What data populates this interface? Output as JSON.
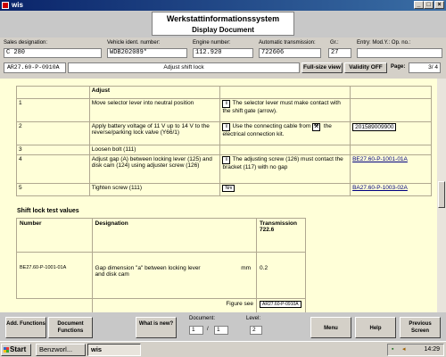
{
  "window": {
    "title": "wis"
  },
  "header": {
    "app_title": "Werkstattinformationssystem",
    "subtitle": "Display Document"
  },
  "fields": [
    {
      "label": "Sales designation:",
      "value": "C 280"
    },
    {
      "label": "Vehicle ident. number:",
      "value": "WDB202089*"
    },
    {
      "label": "Engine number:",
      "value": "112.920"
    },
    {
      "label": "Automatic transmission:",
      "value": "722606"
    },
    {
      "label": "Gr.:",
      "value": "27"
    },
    {
      "label": "Entry: Mod.Y.: Op. no.:",
      "value": ""
    }
  ],
  "infobar": {
    "doc_id": "AR27.60-P-0910A",
    "doc_title": "Adjust shift lock",
    "fullsize": "Full-size view",
    "validity": "Validity OFF",
    "page_label": "Page:",
    "page_value": "3/ 4"
  },
  "adjust_table": {
    "header": "Adjust",
    "rows": [
      {
        "num": "1",
        "step": "Move selector lever into neutral position",
        "note": "The selector lever must make contact with the shift gate (arrow).",
        "ref": ""
      },
      {
        "num": "2",
        "step": "Apply battery voltage of 11 V up to 14 V to the reverse/parking lock valve (Y66/1)",
        "note": "Use the connecting cable from",
        "note2": "the electrical connection kit.",
        "ref": "201589009900"
      },
      {
        "num": "3",
        "step": "Loosen bolt (111)",
        "note": "",
        "ref": ""
      },
      {
        "num": "4",
        "step": "Adjust gap (A) between locking lever (125) and disk cam (124) using adjuster screw (126)",
        "note": "The adjusting screw (126) must contact the bracket (117) with no gap",
        "ref": "BE27.60-P-1001-01A"
      },
      {
        "num": "5",
        "step": "Tighten screw (111)",
        "note": "Nm",
        "ref": "BA27.60-P-1003-02A"
      }
    ]
  },
  "shift_lock": {
    "title": "Shift lock test values",
    "col_number": "Number",
    "col_designation": "Designation",
    "col_transmission": "Transmission",
    "col_transmission_sub": "722.6",
    "row_number": "BE27.60-P-1001-01A",
    "row_designation": "Gap dimension \"a\" between locking lever and disk cam",
    "row_unit": "mm",
    "row_value": "0.2",
    "figure_label": "Figure see",
    "figure_ref": "AR27.60-P-0910A"
  },
  "bottom": {
    "add_functions": "Add. Functions",
    "document_functions": "Document Functions",
    "what_is_new": "What is new?",
    "document_label": "Document:",
    "document_current": "1",
    "document_total": "1",
    "level_label": "Level:",
    "level_value": "2",
    "menu": "Menu",
    "help": "Help",
    "previous_screen": "Previous Screen"
  },
  "taskbar": {
    "start": "Start",
    "items": [
      "Benzworl...",
      "wis"
    ],
    "time": "14:29"
  }
}
